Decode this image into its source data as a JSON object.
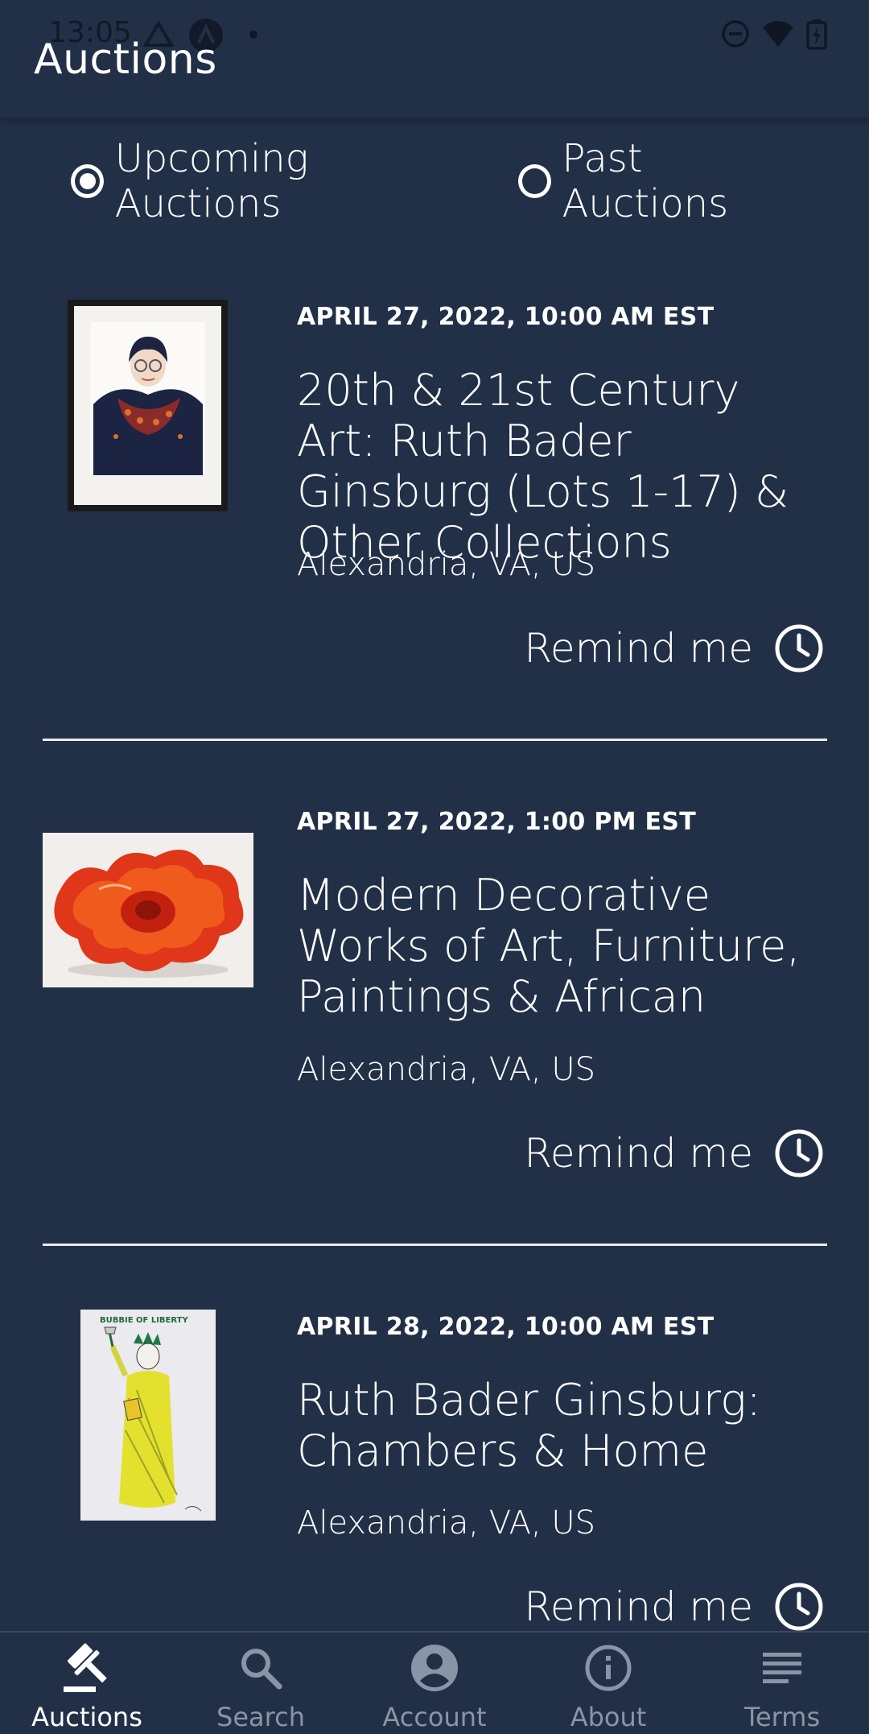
{
  "status_bar": {
    "time": "13:05"
  },
  "header": {
    "title": "Auctions"
  },
  "filter": {
    "options": [
      {
        "label": "Upcoming Auctions",
        "checked": true
      },
      {
        "label": "Past Auctions",
        "checked": false
      }
    ]
  },
  "auctions": [
    {
      "date": "APRIL 27, 2022, 10:00 AM EST",
      "title": "20th & 21st Century Art: Ruth Bader Ginsburg (Lots 1-17) & Other Collections",
      "location": "Alexandria, VA, US",
      "remind_label": "Remind me",
      "image": "framed-portrait-illustration"
    },
    {
      "date": "APRIL 27, 2022, 1:00 PM EST",
      "title": "Modern Decorative Works of Art, Furniture, Paintings & African",
      "location": "Alexandria, VA, US",
      "remind_label": "Remind me",
      "image": "red-glass-bowl"
    },
    {
      "date": "APRIL 28, 2022, 10:00 AM EST",
      "title": "Ruth Bader Ginsburg: Chambers & Home",
      "location": "Alexandria, VA, US",
      "remind_label": "Remind me",
      "image": "statue-of-liberty-drawing"
    }
  ],
  "bottom_nav": {
    "items": [
      {
        "label": "Auctions",
        "icon": "gavel-icon",
        "active": true
      },
      {
        "label": "Search",
        "icon": "search-icon",
        "active": false
      },
      {
        "label": "Account",
        "icon": "account-icon",
        "active": false
      },
      {
        "label": "About",
        "icon": "info-icon",
        "active": false
      },
      {
        "label": "Terms",
        "icon": "lines-icon",
        "active": false
      }
    ]
  },
  "colors": {
    "background": "#223047",
    "text": "#ffffff",
    "inactive_nav": "#8994a6"
  }
}
